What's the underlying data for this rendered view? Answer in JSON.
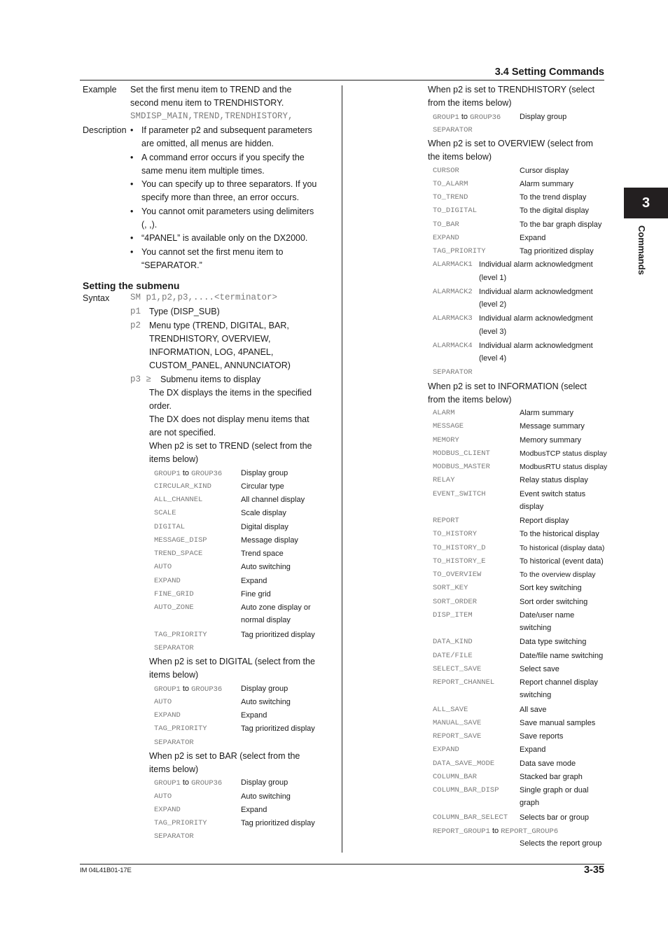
{
  "header": {
    "section_title": "3.4  Setting Commands"
  },
  "chapter_tab": {
    "number": "3",
    "label": "Commands"
  },
  "footer": {
    "doc_id": "IM 04L41B01-17E",
    "page": "3-35"
  },
  "left": {
    "example": {
      "label": "Example",
      "lines": [
        "Set the first menu item to TREND and the",
        "second menu item to TRENDHISTORY."
      ],
      "code": "SMDISP_MAIN,TREND,TRENDHISTORY,"
    },
    "description": {
      "label": "Description",
      "bullets": [
        [
          "If parameter p2 and subsequent parameters",
          "are omitted, all menus are hidden."
        ],
        [
          "A command error occurs if you specify the",
          "same menu item multiple times."
        ],
        [
          "You can specify up to three separators. If you",
          "specify more than three, an error occurs."
        ],
        [
          "You cannot omit parameters using delimiters",
          "(, ,)."
        ],
        [
          "“4PANEL” is available only on the DX2000."
        ],
        [
          "You cannot set the first menu item to",
          "“SEPARATOR.”"
        ]
      ]
    },
    "submenu_heading": "Setting the submenu",
    "syntax": {
      "label": "Syntax",
      "code": "SM p1,p2,p3,....<terminator>",
      "p1": {
        "name": "p1",
        "text": "Type (DISP_SUB)"
      },
      "p2": {
        "name": "p2",
        "lines": [
          "Menu type (TREND, DIGITAL, BAR,",
          "TRENDHISTORY, OVERVIEW,",
          "INFORMATION, LOG, 4PANEL,",
          "CUSTOM_PANEL, ANNUNCIATOR)"
        ]
      },
      "p3": {
        "name": "p3 ≥",
        "text": "Submenu items to display",
        "lines": [
          "The DX displays the items in the specified",
          "order.",
          "The DX does not display menu items that",
          "are not specified."
        ]
      }
    },
    "trend": {
      "intro": [
        "When p2 is set to TREND (select from the",
        "items below)"
      ],
      "items": [
        {
          "key": "GROUP1",
          "to": "to",
          "key2": "GROUP36",
          "value": "Display group"
        },
        {
          "key": "CIRCULAR_KIND",
          "value": "Circular type"
        },
        {
          "key": "ALL_CHANNEL",
          "value": "All channel display"
        },
        {
          "key": "SCALE",
          "value": "Scale display"
        },
        {
          "key": "DIGITAL",
          "value": "Digital display"
        },
        {
          "key": "MESSAGE_DISP",
          "value": "Message display"
        },
        {
          "key": "TREND_SPACE",
          "value": "Trend space"
        },
        {
          "key": "AUTO",
          "value": "Auto switching"
        },
        {
          "key": "EXPAND",
          "value": "Expand"
        },
        {
          "key": "FINE_GRID",
          "value": "Fine grid"
        },
        {
          "key": "AUTO_ZONE",
          "value": "Auto zone display or",
          "value2": "normal display"
        },
        {
          "key": "TAG_PRIORITY",
          "value": "Tag prioritized display"
        },
        {
          "key": "SEPARATOR",
          "value": ""
        }
      ]
    },
    "digital": {
      "intro": [
        "When p2 is set to DIGITAL (select from the",
        "items below)"
      ],
      "items": [
        {
          "key": "GROUP1",
          "to": "to",
          "key2": "GROUP36",
          "value": "Display group"
        },
        {
          "key": "AUTO",
          "value": "Auto switching"
        },
        {
          "key": "EXPAND",
          "value": "Expand"
        },
        {
          "key": "TAG_PRIORITY",
          "value": "Tag prioritized display"
        },
        {
          "key": "SEPARATOR",
          "value": ""
        }
      ]
    },
    "bar": {
      "intro": [
        "When p2 is set to BAR (select from the",
        "items below)"
      ],
      "items": [
        {
          "key": "GROUP1",
          "to": "to",
          "key2": "GROUP36",
          "value": "Display group"
        },
        {
          "key": "AUTO",
          "value": "Auto switching"
        },
        {
          "key": "EXPAND",
          "value": "Expand"
        },
        {
          "key": "TAG_PRIORITY",
          "value": "Tag prioritized display"
        },
        {
          "key": "SEPARATOR",
          "value": ""
        }
      ]
    }
  },
  "right": {
    "trendhistory": {
      "intro": [
        "When p2 is set to TRENDHISTORY (select",
        "from the items below)"
      ],
      "items": [
        {
          "key": "GROUP1",
          "to": "to",
          "key2": "GROUP36",
          "value": "Display group"
        },
        {
          "key": "SEPARATOR",
          "value": ""
        }
      ]
    },
    "overview": {
      "intro": [
        "When p2 is set to OVERVIEW (select from",
        "the items below)"
      ],
      "items": [
        {
          "key": "CURSOR",
          "value": "Cursor display"
        },
        {
          "key": "TO_ALARM",
          "value": "Alarm summary"
        },
        {
          "key": "TO_TREND",
          "value": "To the trend display"
        },
        {
          "key": "TO_DIGITAL",
          "value": "To the digital display"
        },
        {
          "key": "TO_BAR",
          "value": "To the bar graph display"
        },
        {
          "key": "EXPAND",
          "value": "Expand"
        },
        {
          "key": "TAG_PRIORITY",
          "value": "Tag prioritized display"
        },
        {
          "key": "ALARMACK1",
          "value": "Individual alarm acknowledgment",
          "value2": "(level 1)",
          "narrow": true
        },
        {
          "key": "ALARMACK2",
          "value": "Individual alarm acknowledgment",
          "value2": "(level 2)",
          "narrow": true
        },
        {
          "key": "ALARMACK3",
          "value": "Individual alarm acknowledgment",
          "value2": "(level 3)",
          "narrow": true
        },
        {
          "key": "ALARMACK4",
          "value": "Individual alarm acknowledgment",
          "value2": "(level 4)",
          "narrow": true
        },
        {
          "key": "SEPARATOR",
          "value": ""
        }
      ]
    },
    "information": {
      "intro": [
        "When p2 is set to INFORMATION (select",
        "from the items below)"
      ],
      "items": [
        {
          "key": "ALARM",
          "value": "Alarm summary"
        },
        {
          "key": "MESSAGE",
          "value": "Message summary"
        },
        {
          "key": "MEMORY",
          "value": "Memory summary"
        },
        {
          "key": "MODBUS_CLIENT",
          "value": "ModbusTCP status display",
          "small": true
        },
        {
          "key": "MODBUS_MASTER",
          "value": "ModbusRTU status display",
          "small": true
        },
        {
          "key": "RELAY",
          "value": "Relay status display"
        },
        {
          "key": "EVENT_SWITCH",
          "value": "Event switch status",
          "value2": "display"
        },
        {
          "key": "REPORT",
          "value": "Report display"
        },
        {
          "key": "TO_HISTORY",
          "value": "To the historical display"
        },
        {
          "key": "TO_HISTORY_D",
          "value": "To historical (display data)",
          "small": true
        },
        {
          "key": "TO_HISTORY_E",
          "value": "To historical (event data)"
        },
        {
          "key": "TO_OVERVIEW",
          "value": "To the overview display",
          "small": true
        },
        {
          "key": "SORT_KEY",
          "value": "Sort key switching"
        },
        {
          "key": "SORT_ORDER",
          "value": "Sort order switching"
        },
        {
          "key": "DISP_ITEM",
          "value": "Date/user name",
          "value2": "switching"
        },
        {
          "key": "DATA_KIND",
          "value": "Data type switching"
        },
        {
          "key": "DATE/FILE",
          "value": "Date/file name switching"
        },
        {
          "key": "SELECT_SAVE",
          "value": "Select save"
        },
        {
          "key": "REPORT_CHANNEL",
          "value": "Report channel display",
          "value2": "switching"
        },
        {
          "key": "ALL_SAVE",
          "value": "All save"
        },
        {
          "key": "MANUAL_SAVE",
          "value": "Save manual samples"
        },
        {
          "key": "REPORT_SAVE",
          "value": "Save reports"
        },
        {
          "key": "EXPAND",
          "value": "Expand"
        },
        {
          "key": "DATA_SAVE_MODE",
          "value": "Data save mode"
        },
        {
          "key": "COLUMN_BAR",
          "value": "Stacked bar graph"
        },
        {
          "key": "COLUMN_BAR_DISP",
          "value": "Single graph or dual",
          "value2": "graph"
        },
        {
          "key": "COLUMN_BAR_SELECT",
          "value": "Selects bar or group"
        },
        {
          "key": "REPORT_GROUP1",
          "to": "to",
          "key2": "REPORT_GROUP6",
          "value": "",
          "value2": "Selects the report group",
          "range_line": true
        }
      ]
    }
  }
}
